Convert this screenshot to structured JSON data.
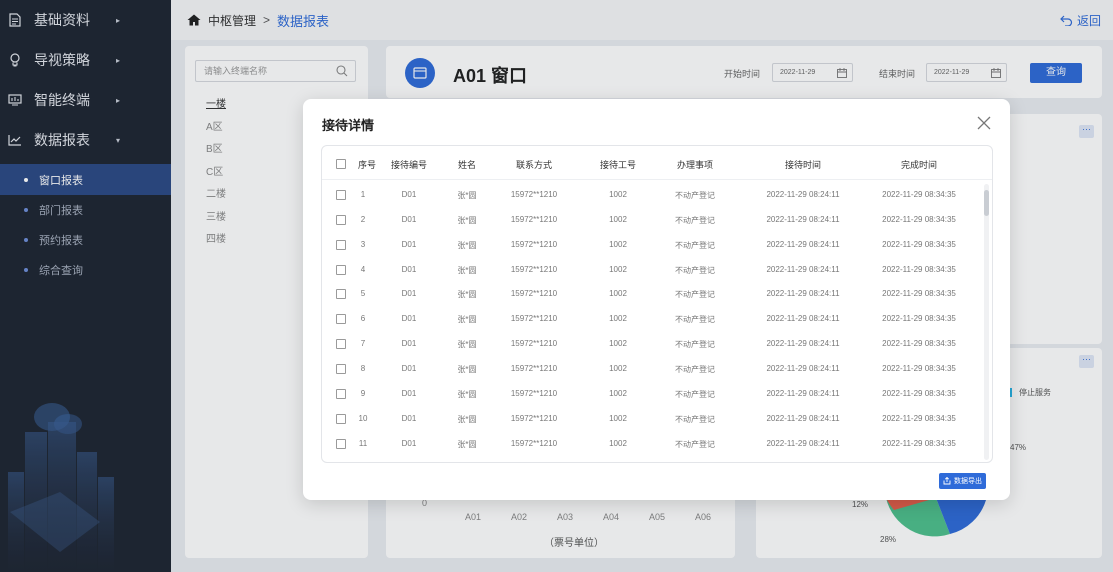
{
  "sidebar": {
    "menu": [
      {
        "label": "基础资料",
        "icon": "document-icon"
      },
      {
        "label": "导视策略",
        "icon": "lightbulb-icon"
      },
      {
        "label": "智能终端",
        "icon": "monitor-icon"
      },
      {
        "label": "数据报表",
        "icon": "chart-line-icon"
      }
    ],
    "submenu": [
      {
        "label": "窗口报表",
        "active": true
      },
      {
        "label": "部门报表",
        "active": false
      },
      {
        "label": "预约报表",
        "active": false
      },
      {
        "label": "综合查询",
        "active": false
      }
    ]
  },
  "header": {
    "breadcrumb_root": "中枢管理",
    "breadcrumb_sep": ">",
    "breadcrumb_current": "数据报表",
    "back_label": "返回"
  },
  "left_panel": {
    "search_placeholder": "请输入终端名称",
    "floors": [
      "一楼",
      "A区",
      "B区",
      "C区",
      "二楼",
      "三楼",
      "四楼"
    ]
  },
  "title_panel": {
    "title": "A01 窗口",
    "start_label": "开始时间",
    "start_value": "2022-11-29",
    "end_label": "结束时间",
    "end_value": "2022-11-29",
    "query_label": "查询"
  },
  "background_chart": {
    "x_ticks": [
      "A01",
      "A02",
      "A03",
      "A04",
      "A05",
      "A06"
    ],
    "zero_tick": "0",
    "x_unit": "（票号单位）",
    "legend_stop": "停止服务",
    "pie_labels": [
      "47%",
      "12%",
      "28%"
    ],
    "more": "···"
  },
  "modal": {
    "title": "接待详情",
    "export_label": "数据导出",
    "columns": [
      "序号",
      "接待编号",
      "姓名",
      "联系方式",
      "接待工号",
      "办理事项",
      "接待时间",
      "完成时间"
    ],
    "rows": [
      {
        "no": "1",
        "code": "D01",
        "name": "张*圆",
        "phone": "15972**1210",
        "staff": "1002",
        "item": "不动产登记",
        "start": "2022-11-29  08:24:11",
        "end": "2022-11-29  08:34:35"
      },
      {
        "no": "2",
        "code": "D01",
        "name": "张*圆",
        "phone": "15972**1210",
        "staff": "1002",
        "item": "不动产登记",
        "start": "2022-11-29  08:24:11",
        "end": "2022-11-29  08:34:35"
      },
      {
        "no": "3",
        "code": "D01",
        "name": "张*圆",
        "phone": "15972**1210",
        "staff": "1002",
        "item": "不动产登记",
        "start": "2022-11-29  08:24:11",
        "end": "2022-11-29  08:34:35"
      },
      {
        "no": "4",
        "code": "D01",
        "name": "张*圆",
        "phone": "15972**1210",
        "staff": "1002",
        "item": "不动产登记",
        "start": "2022-11-29  08:24:11",
        "end": "2022-11-29  08:34:35"
      },
      {
        "no": "5",
        "code": "D01",
        "name": "张*圆",
        "phone": "15972**1210",
        "staff": "1002",
        "item": "不动产登记",
        "start": "2022-11-29  08:24:11",
        "end": "2022-11-29  08:34:35"
      },
      {
        "no": "6",
        "code": "D01",
        "name": "张*圆",
        "phone": "15972**1210",
        "staff": "1002",
        "item": "不动产登记",
        "start": "2022-11-29  08:24:11",
        "end": "2022-11-29  08:34:35"
      },
      {
        "no": "7",
        "code": "D01",
        "name": "张*圆",
        "phone": "15972**1210",
        "staff": "1002",
        "item": "不动产登记",
        "start": "2022-11-29  08:24:11",
        "end": "2022-11-29  08:34:35"
      },
      {
        "no": "8",
        "code": "D01",
        "name": "张*圆",
        "phone": "15972**1210",
        "staff": "1002",
        "item": "不动产登记",
        "start": "2022-11-29  08:24:11",
        "end": "2022-11-29  08:34:35"
      },
      {
        "no": "9",
        "code": "D01",
        "name": "张*圆",
        "phone": "15972**1210",
        "staff": "1002",
        "item": "不动产登记",
        "start": "2022-11-29  08:24:11",
        "end": "2022-11-29  08:34:35"
      },
      {
        "no": "10",
        "code": "D01",
        "name": "张*圆",
        "phone": "15972**1210",
        "staff": "1002",
        "item": "不动产登记",
        "start": "2022-11-29  08:24:11",
        "end": "2022-11-29  08:34:35"
      },
      {
        "no": "11",
        "code": "D01",
        "name": "张*圆",
        "phone": "15972**1210",
        "staff": "1002",
        "item": "不动产登记",
        "start": "2022-11-29  08:24:11",
        "end": "2022-11-29  08:34:35"
      }
    ]
  },
  "colors": {
    "sidebar_bg": "#1f2633",
    "active_item": "#2c4a85",
    "accent": "#2f6bd9",
    "pie_green": "#4fc08d",
    "pie_blue": "#2f6bd9",
    "pie_red": "#e8604c"
  }
}
